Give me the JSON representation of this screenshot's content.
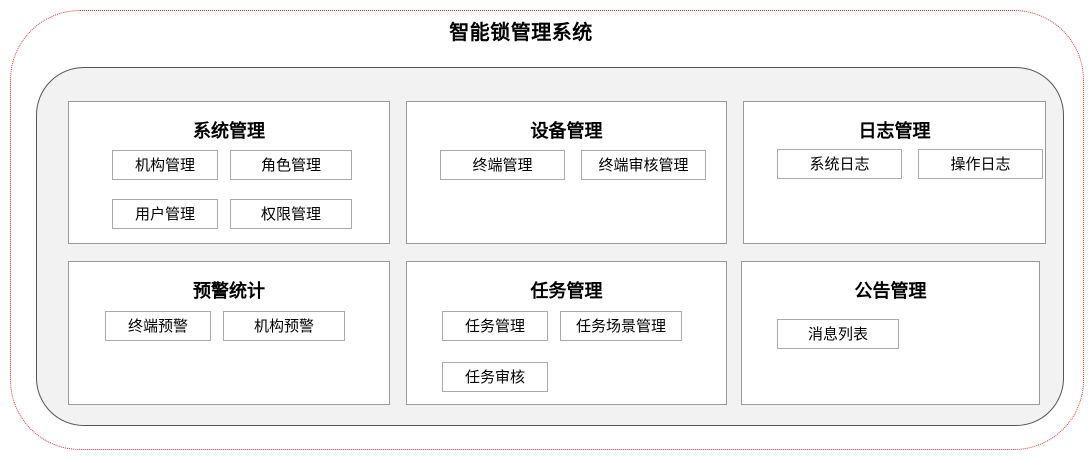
{
  "title": "智能锁管理系统",
  "modules": [
    {
      "title": "系统管理",
      "items": [
        "机构管理",
        "角色管理",
        "用户管理",
        "权限管理"
      ]
    },
    {
      "title": "设备管理",
      "items": [
        "终端管理",
        "终端审核管理"
      ]
    },
    {
      "title": "日志管理",
      "items": [
        "系统日志",
        "操作日志"
      ]
    },
    {
      "title": "预警统计",
      "items": [
        "终端预警",
        "机构预警"
      ]
    },
    {
      "title": "任务管理",
      "items": [
        "任务管理",
        "任务场景管理",
        "任务审核"
      ]
    },
    {
      "title": "公告管理",
      "items": [
        "消息列表"
      ]
    }
  ]
}
